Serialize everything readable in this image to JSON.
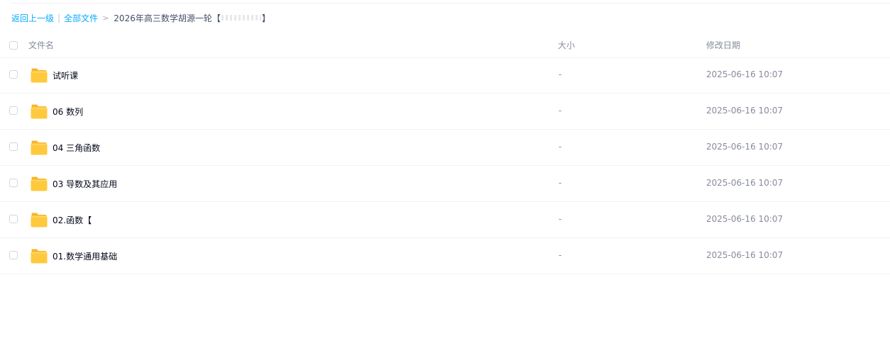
{
  "breadcrumb": {
    "back": "返回上一级",
    "separator": "|",
    "all_files": "全部文件",
    "arrow": ">",
    "current": "2026年高三数学胡源一轮",
    "current_bracket_open": "【",
    "current_bracket_close": "】"
  },
  "columns": {
    "name": "文件名",
    "size": "大小",
    "modified": "修改日期"
  },
  "files": [
    {
      "name": "试听课",
      "size": "-",
      "modified": "2025-06-16 10:07",
      "icon": "folder-icon"
    },
    {
      "name": "06 数列",
      "size": "-",
      "modified": "2025-06-16 10:07",
      "icon": "folder-icon"
    },
    {
      "name": "04 三角函数",
      "size": "-",
      "modified": "2025-06-16 10:07",
      "icon": "folder-icon"
    },
    {
      "name": "03 导数及其应用",
      "size": "-",
      "modified": "2025-06-16 10:07",
      "icon": "folder-icon"
    },
    {
      "name": "02.函数【",
      "size": "-",
      "modified": "2025-06-16 10:07",
      "icon": "folder-icon"
    },
    {
      "name": "01.数学通用基础",
      "size": "-",
      "modified": "2025-06-16 10:07",
      "icon": "folder-icon"
    }
  ],
  "colors": {
    "link": "#09aaff",
    "folder": "#ffc53d",
    "text": "#03081a",
    "muted": "#878c9c"
  }
}
